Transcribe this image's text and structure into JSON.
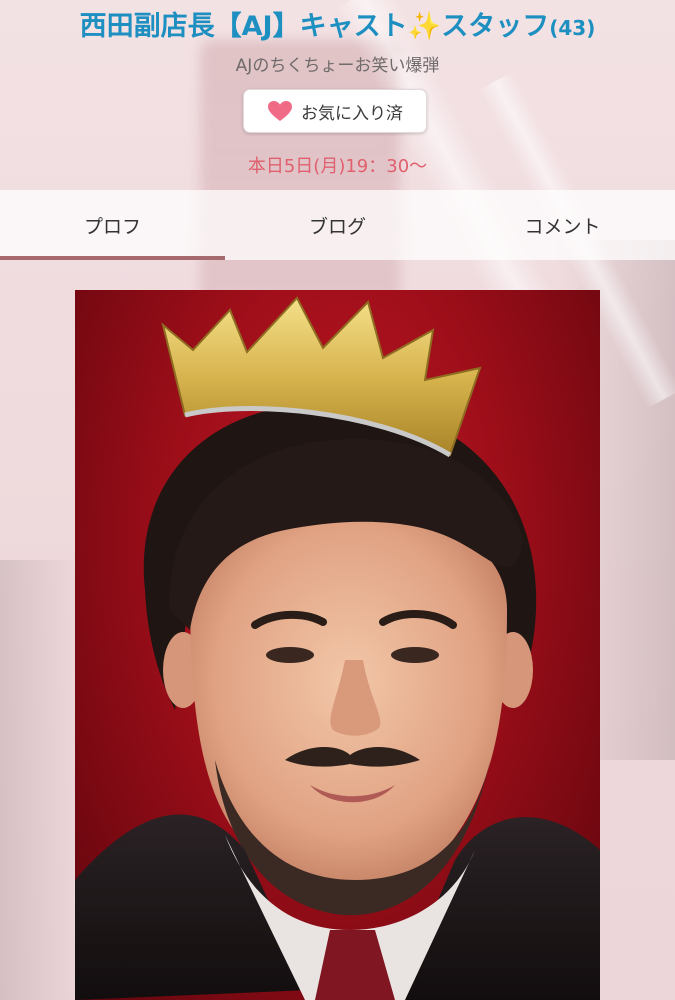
{
  "header": {
    "title_main": "西田副店長【AJ】キャスト",
    "title_sparkle": "✨",
    "title_tail": "スタッフ",
    "title_count": "(43)",
    "subtitle": "AJのちくちょーお笑い爆弾"
  },
  "favorite_button": {
    "icon": "heart-icon",
    "label": "お気に入り済"
  },
  "schedule": "本日5日(月)19：30〜",
  "tabs": [
    {
      "label": "プロフ",
      "active": true
    },
    {
      "label": "ブログ",
      "active": false
    },
    {
      "label": "コメント",
      "active": false
    }
  ],
  "colors": {
    "title": "#1d8fc0",
    "schedule": "#e0606e",
    "heart": "#f06b86",
    "tab_indicator": "#a5696e"
  }
}
